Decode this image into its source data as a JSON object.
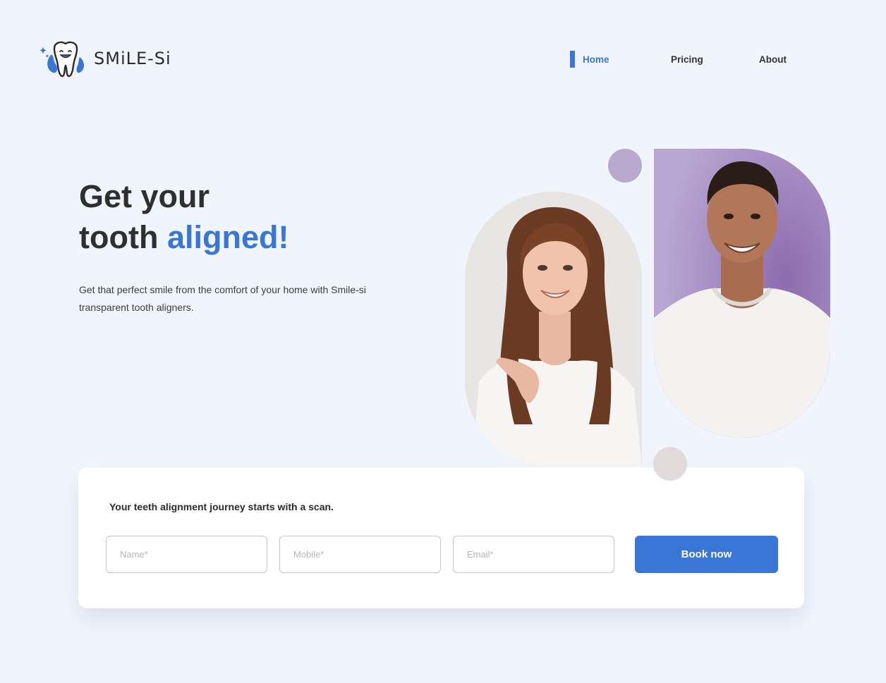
{
  "brand": {
    "name": "SMiLE-Si",
    "logo_icon": "tooth-icon"
  },
  "nav": {
    "items": [
      {
        "label": "Home",
        "active": true
      },
      {
        "label": "Pricing",
        "active": false
      },
      {
        "label": "About",
        "active": false
      }
    ]
  },
  "hero": {
    "title_line1": "Get your",
    "title_line2_plain": "tooth",
    "title_line2_accent": "aligned!",
    "subtitle": "Get that perfect smile from the comfort of your home with Smile-si transparent tooth aligners."
  },
  "booking": {
    "title": "Your teeth alignment journey starts with a scan.",
    "name_placeholder": "Name*",
    "mobile_placeholder": "Mobile*",
    "email_placeholder": "Email*",
    "button_label": "Book now"
  },
  "colors": {
    "accent": "#3a76d5",
    "background": "#f0f5fd",
    "purple_dot": "#b9a9cf",
    "beige_dot": "#e2d9da"
  }
}
